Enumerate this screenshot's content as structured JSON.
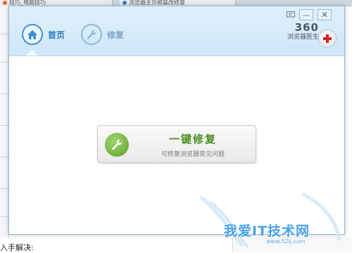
{
  "background": {
    "tabs": [
      {
        "label": "技巧_电脑技巧"
      },
      {
        "label": "浏览器主页被篡改修复"
      }
    ],
    "bottom_text": "入手解决:"
  },
  "dialog": {
    "nav": {
      "home_label": "首页",
      "repair_label": "修复"
    },
    "window_controls": {
      "menu_icon": "menu-icon",
      "minimize": "—",
      "close": "✕"
    },
    "brand": {
      "number": "360",
      "name": "浏览器医生"
    },
    "repair_button": {
      "title": "一键修复",
      "subtitle": "可修复浏览器常见问题"
    }
  },
  "watermark": {
    "text": "我爱IT技术网",
    "url": "www.52ij.com"
  },
  "colors": {
    "accent_blue": "#3e8fd0",
    "header_bg": "#dff0fb",
    "repair_green": "#4e8d23"
  }
}
